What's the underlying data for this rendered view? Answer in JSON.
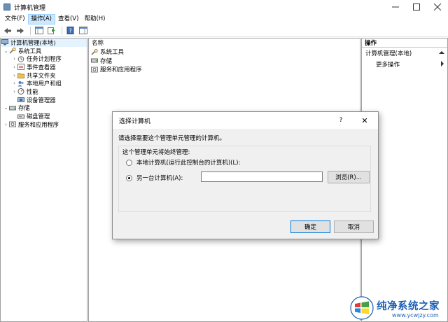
{
  "window": {
    "title": "计算机管理"
  },
  "menu": {
    "items": [
      {
        "label": "文件(F)",
        "active": false
      },
      {
        "label": "操作(A)",
        "active": true
      },
      {
        "label": "查看(V)",
        "active": false
      },
      {
        "label": "帮助(H)",
        "active": false
      }
    ]
  },
  "tree": {
    "root": "计算机管理(本地)",
    "items": [
      {
        "label": "系统工具",
        "level": 1,
        "expander": "⌄",
        "icon": "tools-icon"
      },
      {
        "label": "任务计划程序",
        "level": 2,
        "expander": "›",
        "icon": "clock-icon"
      },
      {
        "label": "事件查看器",
        "level": 2,
        "expander": "›",
        "icon": "event-viewer-icon"
      },
      {
        "label": "共享文件夹",
        "level": 2,
        "expander": "›",
        "icon": "shared-folder-icon"
      },
      {
        "label": "本地用户和组",
        "level": 2,
        "expander": "›",
        "icon": "users-icon"
      },
      {
        "label": "性能",
        "level": 2,
        "expander": "›",
        "icon": "performance-icon"
      },
      {
        "label": "设备管理器",
        "level": 2,
        "expander": "",
        "icon": "device-manager-icon"
      },
      {
        "label": "存储",
        "level": 1,
        "expander": "⌄",
        "icon": "storage-icon"
      },
      {
        "label": "磁盘管理",
        "level": 2,
        "expander": "",
        "icon": "disk-icon"
      },
      {
        "label": "服务和应用程序",
        "level": 1,
        "expander": "›",
        "icon": "services-icon"
      }
    ]
  },
  "list": {
    "column_header": "名称",
    "items": [
      {
        "label": "系统工具",
        "icon": "tools-icon"
      },
      {
        "label": "存储",
        "icon": "storage-icon"
      },
      {
        "label": "服务和应用程序",
        "icon": "services-icon"
      }
    ]
  },
  "actions": {
    "header": "操作",
    "section": "计算机管理(本地)",
    "more": "更多操作"
  },
  "dialog": {
    "title": "选择计算机",
    "help": "?",
    "close": "✕",
    "prompt": "请选择需要这个管理单元管理的计算机。",
    "group_title": "这个管理单元将始终管理:",
    "option_local": "本地计算机(运行此控制台的计算机)(L):",
    "option_other": "另一台计算机(A):",
    "computer_value": "",
    "browse_label": "浏览(R)...",
    "ok_label": "确定",
    "cancel_label": "取消",
    "selected_option": "other"
  },
  "watermark": {
    "title": "纯净系统之家",
    "url": "www.ycwjzy.com"
  },
  "colors": {
    "selection": "#e5f3ff",
    "menu_active": "#cce8ff",
    "accent": "#0078d7",
    "watermark": "#1a5fb4"
  }
}
